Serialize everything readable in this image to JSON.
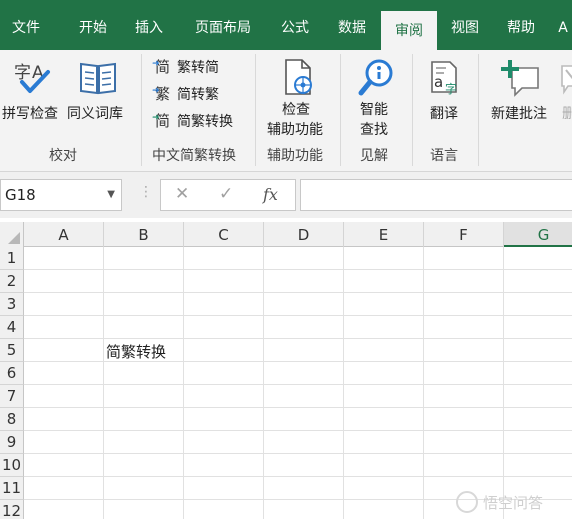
{
  "tabs": [
    {
      "label": "文件",
      "active": false
    },
    {
      "label": "开始",
      "active": false
    },
    {
      "label": "插入",
      "active": false
    },
    {
      "label": "页面布局",
      "active": false
    },
    {
      "label": "公式",
      "active": false
    },
    {
      "label": "数据",
      "active": false
    },
    {
      "label": "审阅",
      "active": true
    },
    {
      "label": "视图",
      "active": false
    },
    {
      "label": "帮助",
      "active": false
    },
    {
      "label": "A",
      "active": false
    }
  ],
  "ribbon": {
    "proofing": {
      "spellcheck_label": "拼写检查",
      "thesaurus_label": "同义词库",
      "group_label": "校对",
      "spellcheck_icon_text": "字A"
    },
    "chinese_conversion": {
      "to_simplified_label": "繁转简",
      "to_traditional_label": "简转繁",
      "convert_label": "简繁转换",
      "to_simplified_icon": "简",
      "to_traditional_icon": "繁",
      "convert_icon": "简",
      "group_label": "中文简繁转换"
    },
    "accessibility": {
      "button_line1": "检查",
      "button_line2": "辅助功能",
      "group_label": "辅助功能"
    },
    "insights": {
      "button_line1": "智能",
      "button_line2": "查找",
      "group_label": "见解"
    },
    "language": {
      "translate_label": "翻译",
      "group_label": "语言",
      "icon_text_a": "a",
      "icon_text_zh": "字"
    },
    "comments": {
      "new_comment_label": "新建批注",
      "delete_label": "删"
    }
  },
  "formula_bar": {
    "name_box": "G18",
    "cancel_icon": "✕",
    "enter_icon": "✓",
    "fx_label": "fx",
    "formula_value": ""
  },
  "grid": {
    "columns": [
      "A",
      "B",
      "C",
      "D",
      "E",
      "F",
      "G"
    ],
    "selected_column": "G",
    "rows": [
      "1",
      "2",
      "3",
      "4",
      "5",
      "6",
      "7",
      "8",
      "9",
      "10",
      "11",
      "12"
    ],
    "cells": {
      "B5": "简繁转换"
    }
  },
  "watermark": {
    "text": "悟空问答"
  },
  "colors": {
    "excel_green": "#217346",
    "ribbon_bg": "#f3f3f3",
    "icon_blue": "#2a7bd3",
    "icon_teal": "#1e8b6a"
  }
}
